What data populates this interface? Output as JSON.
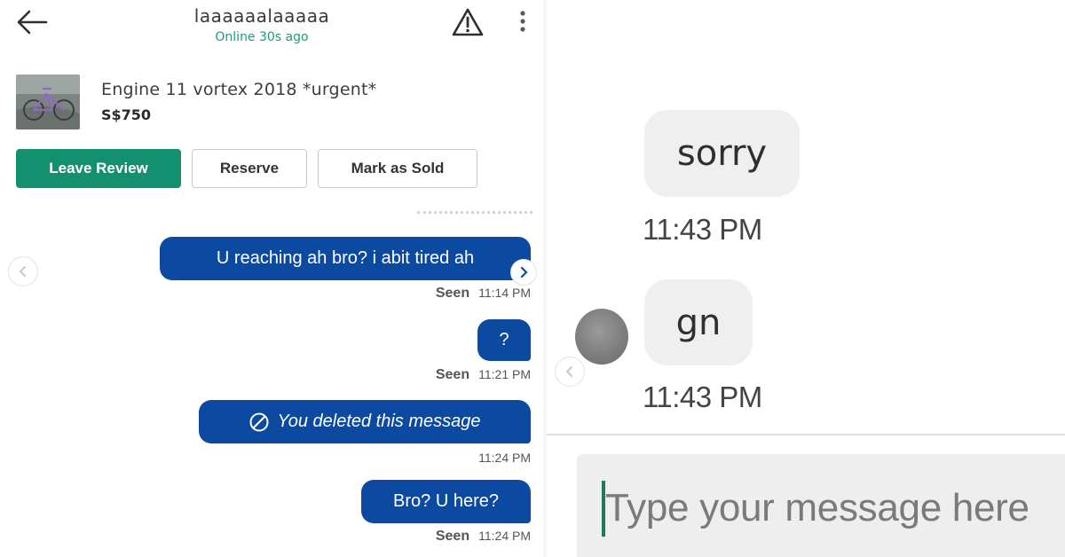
{
  "left_chat": {
    "header": {
      "name": "laaaaaalaaaaa",
      "status": "Online 30s ago"
    },
    "listing": {
      "title": "Engine 11 vortex 2018 *urgent*",
      "price": "S$750"
    },
    "actions": {
      "leave_review": "Leave Review",
      "reserve": "Reserve",
      "mark_sold": "Mark as Sold"
    },
    "messages": [
      {
        "text": "U reaching ah bro? i abit tired ah",
        "seen": "Seen",
        "time": "11:14 PM"
      },
      {
        "text": "?",
        "seen": "Seen",
        "time": "11:21 PM"
      },
      {
        "text": "You deleted this message",
        "icon": "deleted-icon",
        "time": "11:24 PM"
      },
      {
        "text": "Bro? U here?",
        "seen": "Seen",
        "time": "11:24 PM"
      }
    ],
    "accent_color": "#12906f",
    "bubble_color": "#0b4aa0"
  },
  "right_chat": {
    "messages": [
      {
        "text": "sorry",
        "time": "11:43 PM"
      },
      {
        "text": "gn",
        "time": "11:43 PM"
      }
    ],
    "composer": {
      "placeholder": "Type your message here"
    },
    "bubble_color": "#efefef"
  }
}
